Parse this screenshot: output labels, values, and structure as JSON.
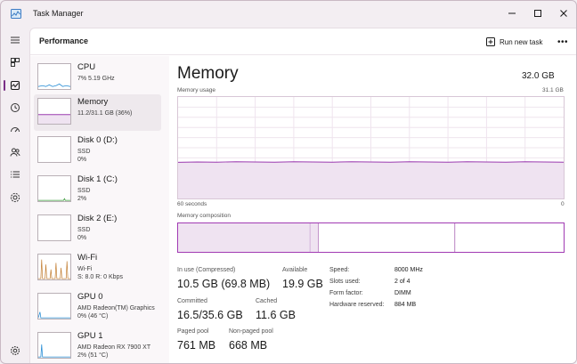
{
  "window": {
    "title": "Task Manager"
  },
  "header": {
    "title": "Performance",
    "run_new_task": "Run new task",
    "more": "•••"
  },
  "rail": {
    "items": [
      "hamburger-icon",
      "processes-icon",
      "performance-icon",
      "app-history-icon",
      "startup-apps-icon",
      "users-icon",
      "details-icon",
      "services-icon"
    ],
    "settings": "settings-icon"
  },
  "resources": [
    {
      "name": "CPU",
      "sub": [
        "7%  5.19 GHz"
      ],
      "graph_color": "#2a8fd6"
    },
    {
      "name": "Memory",
      "sub": [
        "11.2/31.1 GB (36%)"
      ],
      "graph_color": "#9b3bb0"
    },
    {
      "name": "Disk 0 (D:)",
      "sub": [
        "SSD",
        "0%"
      ],
      "graph_color": "#3a9a3a"
    },
    {
      "name": "Disk 1 (C:)",
      "sub": [
        "SSD",
        "2%"
      ],
      "graph_color": "#3a9a3a"
    },
    {
      "name": "Disk 2 (E:)",
      "sub": [
        "SSD",
        "0%"
      ],
      "graph_color": "#3a9a3a"
    },
    {
      "name": "Wi-Fi",
      "sub": [
        "Wi-Fi",
        "S: 8.0  R: 0 Kbps"
      ],
      "graph_color": "#c07a2c"
    },
    {
      "name": "GPU 0",
      "sub": [
        "AMD Radeon(TM) Graphics",
        "0%  (46 °C)"
      ],
      "graph_color": "#2a8fd6"
    },
    {
      "name": "GPU 1",
      "sub": [
        "AMD Radeon RX 7900 XT",
        "2%  (51 °C)"
      ],
      "graph_color": "#2a8fd6"
    }
  ],
  "memory": {
    "title": "Memory",
    "total": "32.0 GB",
    "usage_label": "Memory usage",
    "usage_max": "31.1 GB",
    "time_left": "60 seconds",
    "time_right": "0",
    "composition_label": "Memory composition",
    "accent": "#9b3bb0",
    "in_use_fraction": 0.36,
    "stats": {
      "in_use_label": "In use (Compressed)",
      "in_use": "10.5 GB (69.8 MB)",
      "available_label": "Available",
      "available": "19.9 GB",
      "committed_label": "Committed",
      "committed": "16.5/35.6 GB",
      "cached_label": "Cached",
      "cached": "11.6 GB",
      "paged_label": "Paged pool",
      "paged": "761 MB",
      "nonpaged_label": "Non-paged pool",
      "nonpaged": "668 MB"
    },
    "specs": [
      {
        "label": "Speed:",
        "value": "8000 MHz"
      },
      {
        "label": "Slots used:",
        "value": "2 of 4"
      },
      {
        "label": "Form factor:",
        "value": "DIMM"
      },
      {
        "label": "Hardware reserved:",
        "value": "884 MB"
      }
    ]
  }
}
